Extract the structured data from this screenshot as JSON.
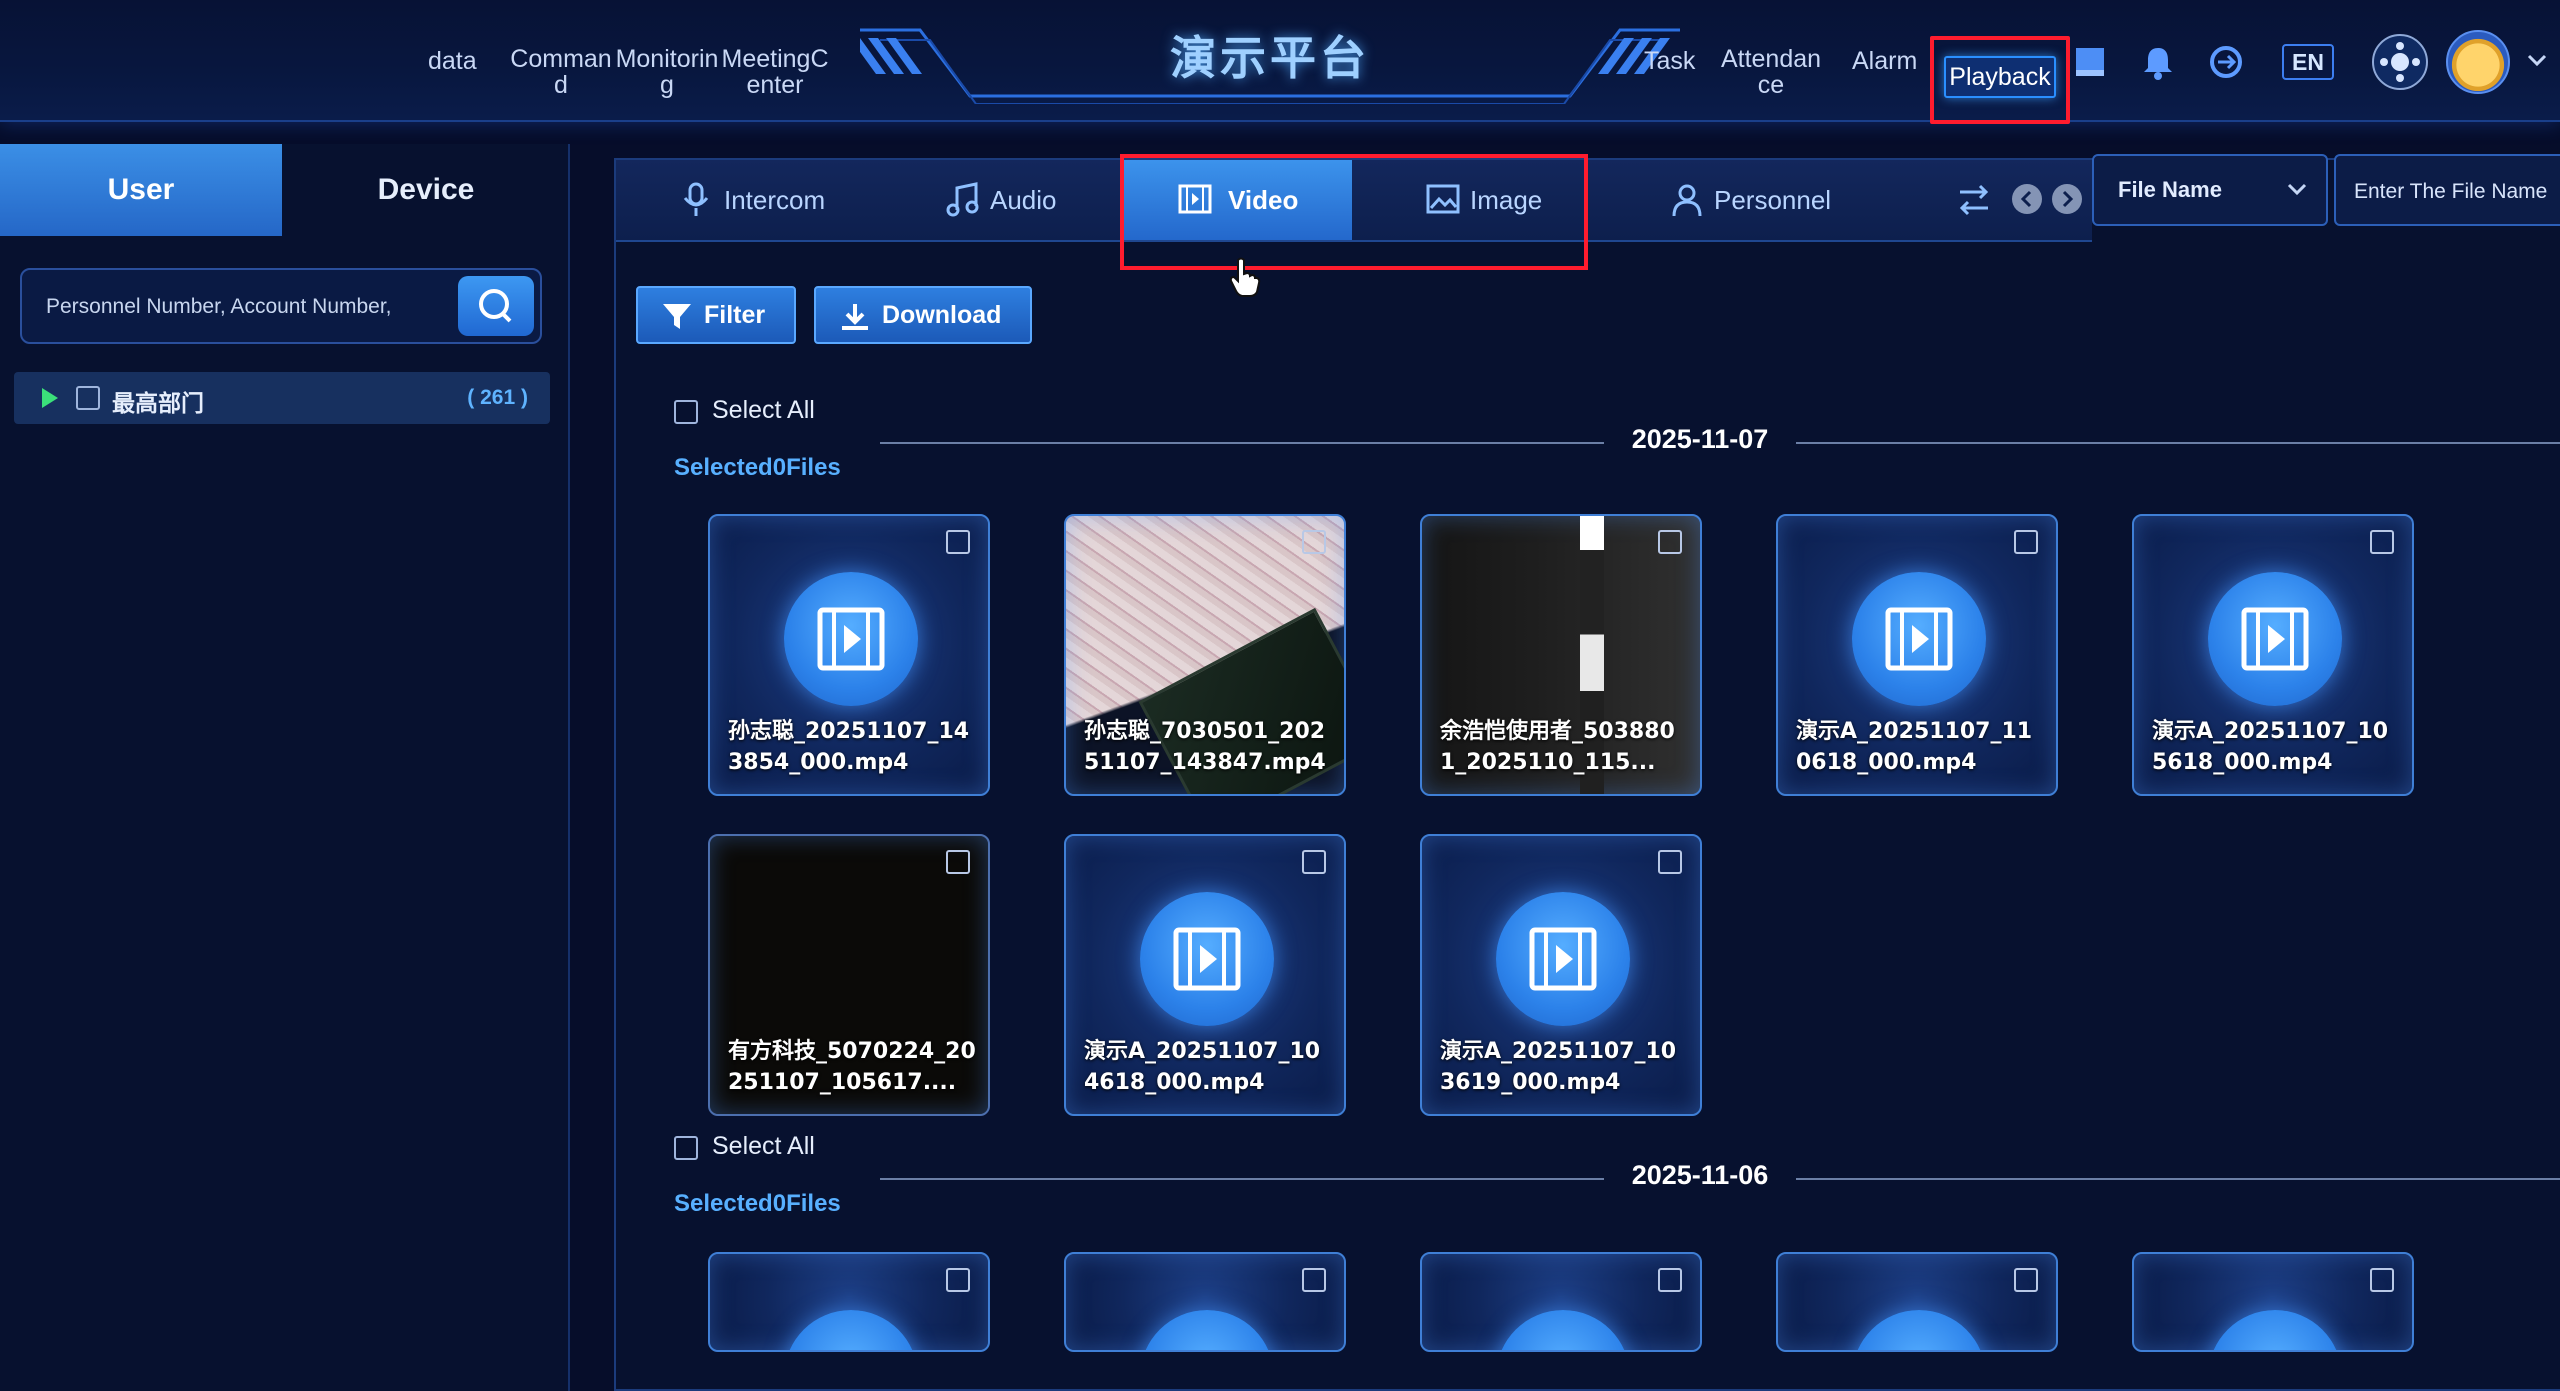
{
  "app": {
    "title": "演示平台"
  },
  "nav": {
    "left": [
      {
        "id": "data",
        "label": "data"
      },
      {
        "id": "command",
        "label": "Command"
      },
      {
        "id": "monitoring",
        "label": "Monitoring"
      },
      {
        "id": "meeting",
        "label": "MeetingCenter"
      }
    ],
    "right": [
      {
        "id": "task",
        "label": "Task"
      },
      {
        "id": "attendance",
        "label": "Attendance"
      },
      {
        "id": "alarm",
        "label": "Alarm"
      },
      {
        "id": "playback",
        "label": "Playback"
      }
    ],
    "language": "EN"
  },
  "left_panel": {
    "tabs": [
      {
        "label": "User"
      },
      {
        "label": "Device"
      }
    ],
    "search_placeholder": "Personnel Number, Account Number,",
    "tree": {
      "label": "最高部门",
      "count": "( 261 )"
    }
  },
  "main": {
    "tabs": [
      {
        "label": "Intercom"
      },
      {
        "label": "Audio"
      },
      {
        "label": "Video"
      },
      {
        "label": "Image"
      },
      {
        "label": "Personnel"
      }
    ],
    "filter_select": "File Name",
    "file_input_placeholder": "Enter The File Name",
    "buttons": {
      "filter": "Filter",
      "download": "Download"
    },
    "groups": [
      {
        "date": "2025-11-07",
        "select_all": "Select All",
        "selected": "Selected0Files",
        "files": [
          {
            "name": "孙志聪_20251107_143854_000.mp4",
            "thumb": "video-icon"
          },
          {
            "name": "孙志聪_7030501_20251107_143847.mp4",
            "thumb": "map-photo"
          },
          {
            "name": "余浩恺使用者_5038801_2025110_115...",
            "thumb": "dark-photo"
          },
          {
            "name": "演示A_20251107_110618_000.mp4",
            "thumb": "video-icon"
          },
          {
            "name": "演示A_20251107_105618_000.mp4",
            "thumb": "video-icon"
          },
          {
            "name": "有方科技_5070224_20251107_105617....",
            "thumb": "black-photo"
          },
          {
            "name": "演示A_20251107_104618_000.mp4",
            "thumb": "video-icon"
          },
          {
            "name": "演示A_20251107_103619_000.mp4",
            "thumb": "video-icon"
          }
        ]
      },
      {
        "date": "2025-11-06",
        "select_all": "Select All",
        "selected": "Selected0Files"
      }
    ]
  },
  "colors": {
    "background": "#060d2a",
    "accent": "#2c82ea",
    "highlight": "#ff1c2e",
    "selected_text": "#58b0ff"
  }
}
